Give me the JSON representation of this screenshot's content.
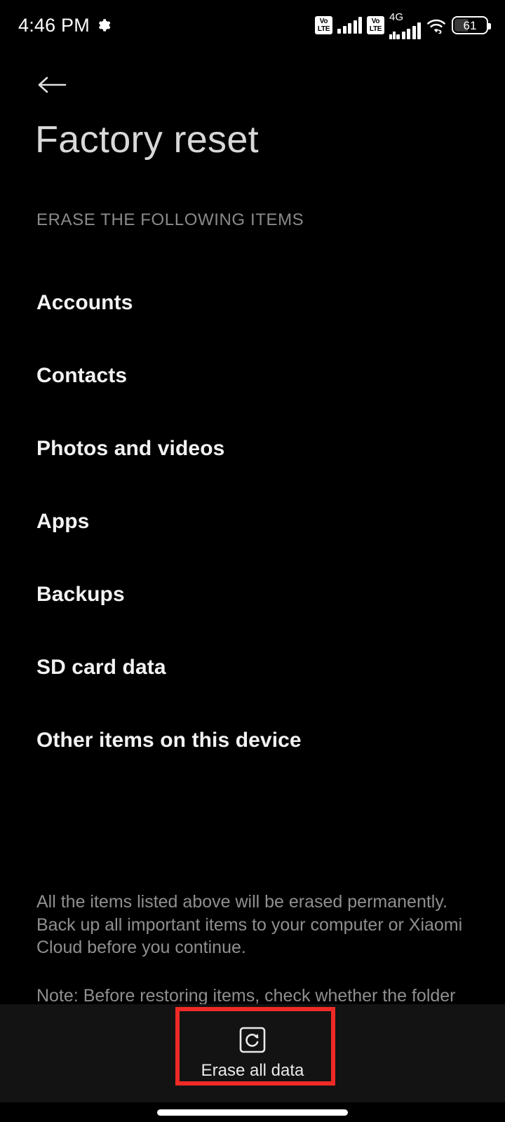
{
  "status_bar": {
    "time": "4:46 PM",
    "gear_icon": "gear-icon",
    "sim1_volte_top": "Vo",
    "sim1_volte_bottom": "LTE",
    "sim2_volte_top": "Vo",
    "sim2_volte_bottom": "LTE",
    "network_type": "4G",
    "wifi_icon": "wifi-icon",
    "battery_level": "61"
  },
  "header": {
    "back_icon": "back-arrow-icon",
    "title": "Factory reset"
  },
  "section": {
    "header": "ERASE THE FOLLOWING ITEMS"
  },
  "items": [
    {
      "label": "Accounts"
    },
    {
      "label": "Contacts"
    },
    {
      "label": "Photos and videos"
    },
    {
      "label": "Apps"
    },
    {
      "label": "Backups"
    },
    {
      "label": "SD card data"
    },
    {
      "label": "Other items on this device"
    }
  ],
  "footnotes": {
    "disclaimer": "All the items listed above will be erased permanently. Back up all important items to your computer or Xiaomi Cloud before you continue.",
    "note": "Note: Before restoring items, check whether the folder"
  },
  "bottom_bar": {
    "erase_icon": "reset-restore-icon",
    "erase_label": "Erase all data"
  },
  "highlight": {
    "color": "#ee2a26"
  },
  "navigation": {
    "gesture_pill": "home-gesture-pill"
  }
}
